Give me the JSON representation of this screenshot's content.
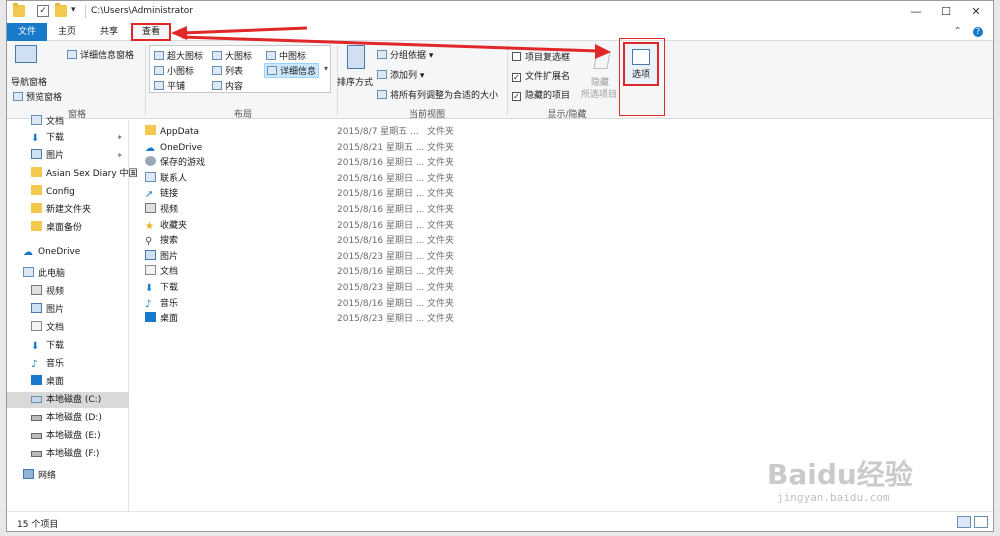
{
  "window": {
    "path": "C:\\Users\\Administrator",
    "controls": {
      "minimize": "—",
      "maximize": "☐",
      "close": "✕"
    },
    "qa_check": "✓",
    "qa_dropdown": "▾"
  },
  "tabs": [
    {
      "label": "文件"
    },
    {
      "label": "主页"
    },
    {
      "label": "共享"
    },
    {
      "label": "查看"
    }
  ],
  "ribbon_help": "?",
  "ribbon_collapse": "⌃",
  "ribbon": {
    "panes": {
      "nav_pane": "导航窗格",
      "preview_pane": "预览窗格",
      "details_pane": "详细信息窗格",
      "label": "窗格"
    },
    "layout": {
      "items": [
        "超大图标",
        "大图标",
        "中图标",
        "小图标",
        "列表",
        "详细信息",
        "平铺",
        "内容"
      ],
      "selected": "详细信息",
      "label": "布局"
    },
    "current_view": {
      "sort": "排序方式",
      "group_by": "分组依据",
      "add_column": "添加列",
      "fit_columns": "将所有列调整为合适的大小",
      "label": "当前视图"
    },
    "show_hide": {
      "item_checkbox": "项目复选框",
      "file_ext": "文件扩展名",
      "hidden_items": "隐藏的项目",
      "file_ext_checked": true,
      "hidden_items_checked": true,
      "hide_label": "隐藏",
      "hide_sub": "所选项目",
      "label": "显示/隐藏"
    },
    "options": "选项"
  },
  "nav": {
    "items": [
      {
        "label": "文档",
        "pinned": true
      },
      {
        "label": "下载",
        "pinned": true
      },
      {
        "label": "图片",
        "pinned": true
      },
      {
        "label": "Asian Sex Diary 中国"
      },
      {
        "label": "Config"
      },
      {
        "label": "新建文件夹"
      },
      {
        "label": "桌面备份"
      },
      {
        "label": "OneDrive"
      },
      {
        "label": "此电脑"
      },
      {
        "label": "视频"
      },
      {
        "label": "图片"
      },
      {
        "label": "文档"
      },
      {
        "label": "下载"
      },
      {
        "label": "音乐"
      },
      {
        "label": "桌面"
      },
      {
        "label": "本地磁盘 (C:)",
        "selected": true
      },
      {
        "label": "本地磁盘 (D:)"
      },
      {
        "label": "本地磁盘 (E:)"
      },
      {
        "label": "本地磁盘 (F:)"
      },
      {
        "label": "网络"
      }
    ]
  },
  "files": [
    {
      "name": "AppData",
      "date": "2015/8/7 星期五 ...",
      "type": "文件夹"
    },
    {
      "name": "OneDrive",
      "date": "2015/8/21 星期五 ...",
      "type": "文件夹"
    },
    {
      "name": "保存的游戏",
      "date": "2015/8/16 星期日 ...",
      "type": "文件夹"
    },
    {
      "name": "联系人",
      "date": "2015/8/16 星期日 ...",
      "type": "文件夹"
    },
    {
      "name": "链接",
      "date": "2015/8/16 星期日 ...",
      "type": "文件夹"
    },
    {
      "name": "视频",
      "date": "2015/8/16 星期日 ...",
      "type": "文件夹"
    },
    {
      "name": "收藏夹",
      "date": "2015/8/16 星期日 ...",
      "type": "文件夹"
    },
    {
      "name": "搜索",
      "date": "2015/8/16 星期日 ...",
      "type": "文件夹"
    },
    {
      "name": "图片",
      "date": "2015/8/23 星期日 ...",
      "type": "文件夹"
    },
    {
      "name": "文档",
      "date": "2015/8/16 星期日 ...",
      "type": "文件夹"
    },
    {
      "name": "下载",
      "date": "2015/8/23 星期日 ...",
      "type": "文件夹"
    },
    {
      "name": "音乐",
      "date": "2015/8/16 星期日 ...",
      "type": "文件夹"
    },
    {
      "name": "桌面",
      "date": "2015/8/23 星期日 ...",
      "type": "文件夹"
    }
  ],
  "status": {
    "count": "15 个项目"
  },
  "watermark": {
    "text": "Baidu经验",
    "sub": "jingyan.baidu.com"
  },
  "colors": {
    "accent": "#1979ca",
    "highlight": "#e02828",
    "selected_nav": "#d9d9d9"
  }
}
